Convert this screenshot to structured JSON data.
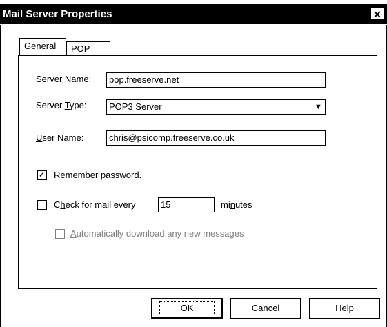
{
  "window": {
    "title": "Mail Server Properties",
    "close_glyph": "✕"
  },
  "tabs": [
    {
      "label": "General",
      "active": true
    },
    {
      "label": "POP",
      "active": false
    }
  ],
  "form": {
    "server_name": {
      "label_pre": "",
      "label_ul": "S",
      "label_post": "erver Name:",
      "value": "pop.freeserve.net"
    },
    "server_type": {
      "label_pre": "Server ",
      "label_ul": "T",
      "label_post": "ype:",
      "value": "POP3 Server"
    },
    "user_name": {
      "label_pre": "",
      "label_ul": "U",
      "label_post": "ser Name:",
      "value": "chris@psicomp.freeserve.co.uk"
    },
    "remember_password": {
      "label_pre": "Remember ",
      "label_ul": "p",
      "label_post": "assword.",
      "checked": true,
      "check_glyph": "✓"
    },
    "check_mail": {
      "label_pre": "C",
      "label_ul": "h",
      "label_post": "eck for mail every",
      "checked": false,
      "interval": "15",
      "unit_pre": "mi",
      "unit_ul": "n",
      "unit_post": "utes"
    },
    "auto_download": {
      "label_pre": "",
      "label_ul": "A",
      "label_post": "utomatically download any new messages",
      "checked": false,
      "enabled": false
    }
  },
  "buttons": {
    "ok": "OK",
    "cancel": "Cancel",
    "help": "Help"
  },
  "colors": {
    "titlebar": "#000000",
    "disabled_text": "#808080"
  }
}
